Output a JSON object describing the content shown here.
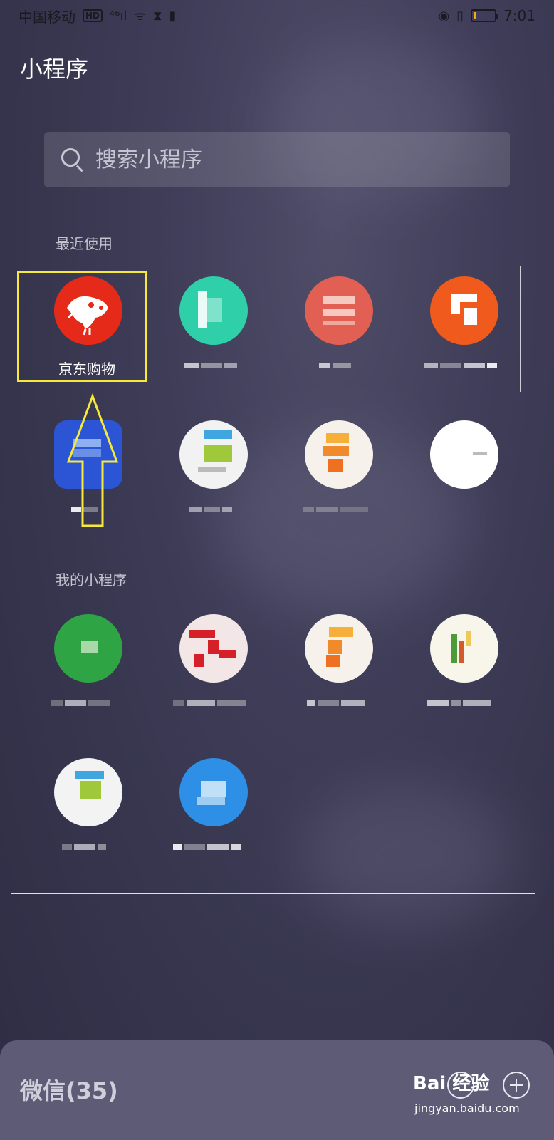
{
  "status_bar": {
    "carrier": "中国移动",
    "hd_badge": "HD",
    "signal": "⁴⁶ıl",
    "wifi": "ᯤ",
    "time": "7:01",
    "battery_level": 0.15
  },
  "header": {
    "title": "小程序"
  },
  "search": {
    "placeholder": "搜索小程序"
  },
  "sections": {
    "recent": "最近使用",
    "mine": "我的小程序"
  },
  "apps": {
    "jd": {
      "label": "京东购物"
    }
  },
  "bottom": {
    "title": "微信(35)",
    "watermark": "Bai 经验",
    "watermark_sub": "jingyan.baidu.com"
  },
  "colors": {
    "highlight": "#f6e93a",
    "jd_red": "#e52a1a"
  }
}
